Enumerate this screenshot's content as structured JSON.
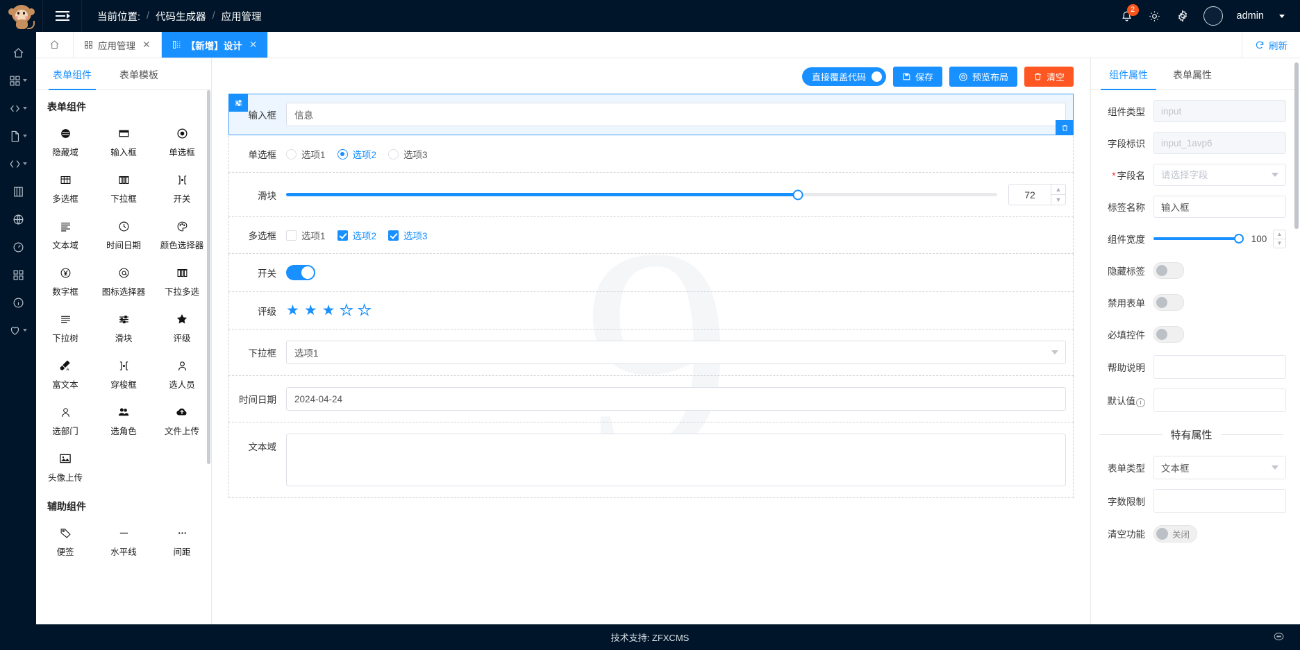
{
  "topbar": {
    "logo": "monkey-logo",
    "menu_toggle": "menu-fold-icon",
    "breadcrumb_label": "当前位置:",
    "breadcrumb": [
      "代码生成器",
      "应用管理"
    ],
    "separator": "/",
    "bell_badge": "2",
    "username": "admin",
    "icons": [
      "bell-icon",
      "brightness-icon",
      "gear-icon"
    ]
  },
  "rail": {
    "items": [
      {
        "name": "home-icon",
        "caret": false
      },
      {
        "name": "apps-icon",
        "caret": true
      },
      {
        "name": "code-icon",
        "caret": true
      },
      {
        "name": "file-icon",
        "caret": true
      },
      {
        "name": "code-brackets-icon",
        "caret": true
      },
      {
        "name": "database-icon",
        "caret": false
      },
      {
        "name": "globe-icon",
        "caret": false
      },
      {
        "name": "dashboard-icon",
        "caret": false
      },
      {
        "name": "grid-icon",
        "caret": false
      },
      {
        "name": "info-icon",
        "caret": false
      },
      {
        "name": "heart-icon",
        "caret": true
      }
    ]
  },
  "tabstrip": {
    "home_icon": "home-outline-icon",
    "tabs": [
      {
        "label": "应用管理",
        "icon": "apps-icon",
        "active": false,
        "closable": true
      },
      {
        "label": "【新增】设计",
        "icon": "design-icon",
        "active": true,
        "closable": true
      }
    ],
    "refresh_label": "刷新",
    "refresh_icon": "refresh-icon"
  },
  "palette": {
    "tabs": [
      {
        "label": "表单组件",
        "active": true
      },
      {
        "label": "表单模板",
        "active": false
      }
    ],
    "groups": [
      {
        "title": "表单组件",
        "items": [
          {
            "label": "隐藏域",
            "icon": "hidden-field-icon"
          },
          {
            "label": "输入框",
            "icon": "input-icon"
          },
          {
            "label": "单选框",
            "icon": "radio-icon"
          },
          {
            "label": "多选框",
            "icon": "checkbox-icon"
          },
          {
            "label": "下拉框",
            "icon": "select-icon"
          },
          {
            "label": "开关",
            "icon": "switch-icon"
          },
          {
            "label": "文本域",
            "icon": "textarea-icon"
          },
          {
            "label": "时间日期",
            "icon": "clock-icon"
          },
          {
            "label": "颜色选择器",
            "icon": "palette-icon"
          },
          {
            "label": "数字框",
            "icon": "currency-icon"
          },
          {
            "label": "图标选择器",
            "icon": "at-icon"
          },
          {
            "label": "下拉多选",
            "icon": "multiselect-icon"
          },
          {
            "label": "下拉树",
            "icon": "tree-select-icon"
          },
          {
            "label": "滑块",
            "icon": "slider-icon"
          },
          {
            "label": "评级",
            "icon": "star-icon"
          },
          {
            "label": "富文本",
            "icon": "richtext-icon"
          },
          {
            "label": "穿梭框",
            "icon": "transfer-icon"
          },
          {
            "label": "选人员",
            "icon": "user-icon"
          },
          {
            "label": "选部门",
            "icon": "department-icon"
          },
          {
            "label": "选角色",
            "icon": "role-icon"
          },
          {
            "label": "文件上传",
            "icon": "upload-icon"
          },
          {
            "label": "头像上传",
            "icon": "image-upload-icon"
          }
        ]
      },
      {
        "title": "辅助组件",
        "items": [
          {
            "label": "便签",
            "icon": "tag-icon"
          },
          {
            "label": "水平线",
            "icon": "divider-icon"
          },
          {
            "label": "间距",
            "icon": "spacing-icon"
          }
        ]
      }
    ]
  },
  "canvas": {
    "toolbar": {
      "overwrite_label": "直接覆盖代码",
      "overwrite_on": false,
      "save_label": "保存",
      "save_icon": "save-icon",
      "preview_label": "预览布局",
      "preview_icon": "preview-icon",
      "clear_label": "清空",
      "clear_icon": "trash-icon"
    },
    "watermark": "9",
    "rows": [
      {
        "type": "input",
        "label": "输入框",
        "value": "信息",
        "selected": true,
        "drag_icon": "drag-handle-icon",
        "delete_icon": "trash-icon"
      },
      {
        "type": "radio",
        "label": "单选框",
        "options": [
          "选项1",
          "选项2",
          "选项3"
        ],
        "selected_index": 1
      },
      {
        "type": "slider",
        "label": "滑块",
        "value": 72,
        "min": 0,
        "max": 100
      },
      {
        "type": "checkbox",
        "label": "多选框",
        "options": [
          "选项1",
          "选项2",
          "选项3"
        ],
        "checked": [
          false,
          true,
          true
        ]
      },
      {
        "type": "switch",
        "label": "开关",
        "on": true
      },
      {
        "type": "rate",
        "label": "评级",
        "value": 3,
        "max": 5
      },
      {
        "type": "select",
        "label": "下拉框",
        "value": "选项1"
      },
      {
        "type": "date",
        "label": "时间日期",
        "value": "2024-04-24"
      },
      {
        "type": "textarea",
        "label": "文本域",
        "value": ""
      }
    ]
  },
  "props": {
    "tabs": [
      {
        "label": "组件属性",
        "active": true
      },
      {
        "label": "表单属性",
        "active": false
      }
    ],
    "fields": [
      {
        "label": "组件类型",
        "kind": "input-disabled",
        "value": "",
        "placeholder": "input"
      },
      {
        "label": "字段标识",
        "kind": "input-disabled",
        "value": "",
        "placeholder": "input_1avp6"
      },
      {
        "label": "字段名",
        "kind": "select",
        "value": "",
        "placeholder": "请选择字段",
        "required": true
      },
      {
        "label": "标签名称",
        "kind": "input",
        "value": "输入框",
        "placeholder": ""
      },
      {
        "label": "组件宽度",
        "kind": "slider-number",
        "value": 100,
        "min": 0,
        "max": 100
      },
      {
        "label": "隐藏标签",
        "kind": "toggle",
        "on": false
      },
      {
        "label": "禁用表单",
        "kind": "toggle",
        "on": false
      },
      {
        "label": "必填控件",
        "kind": "toggle",
        "on": false
      },
      {
        "label": "帮助说明",
        "kind": "input",
        "value": "",
        "placeholder": ""
      },
      {
        "label": "默认值",
        "kind": "input",
        "value": "",
        "placeholder": "",
        "info": true
      }
    ],
    "section_title": "特有属性",
    "special_fields": [
      {
        "label": "表单类型",
        "kind": "select",
        "value": "文本框",
        "placeholder": ""
      },
      {
        "label": "字数限制",
        "kind": "input",
        "value": "",
        "placeholder": ""
      },
      {
        "label": "清空功能",
        "kind": "toggle-label",
        "on": false,
        "text": "关闭"
      }
    ]
  },
  "footer": {
    "text": "技术支持: ZFXCMS",
    "right_icon": "chat-icon"
  },
  "colors": {
    "primary": "#1890ff",
    "danger": "#ff5722",
    "dark": "#001529",
    "badge": "#fa541c"
  }
}
